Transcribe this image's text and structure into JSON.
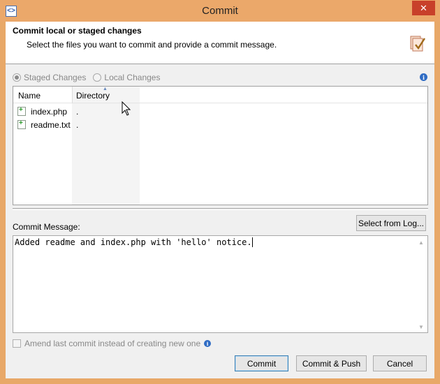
{
  "window": {
    "title": "Commit",
    "close_glyph": "✕",
    "app_icon": "git-app-icon"
  },
  "header": {
    "title": "Commit local or staged changes",
    "subtitle": "Select the files you want to commit and provide a commit message.",
    "icon": "commit-checkmark-icon"
  },
  "mode": {
    "options": [
      {
        "label": "Staged Changes",
        "selected": true
      },
      {
        "label": "Local Changes",
        "selected": false
      }
    ],
    "info_glyph": "i"
  },
  "files": {
    "columns": [
      "Name",
      "Directory"
    ],
    "rows": [
      {
        "name": "index.php",
        "directory": "."
      },
      {
        "name": "readme.txt",
        "directory": "."
      }
    ]
  },
  "message": {
    "label": "Commit Message:",
    "select_from_log_label": "Select from Log...",
    "value": "Added readme and index.php with 'hello' notice."
  },
  "amend": {
    "label": "Amend last commit instead of creating new one",
    "checked": false,
    "info_glyph": "i"
  },
  "buttons": {
    "commit": "Commit",
    "commit_push": "Commit & Push",
    "cancel": "Cancel"
  },
  "colors": {
    "titlebar": "#eba86a",
    "close": "#c8402a",
    "info": "#2f6cc4"
  }
}
